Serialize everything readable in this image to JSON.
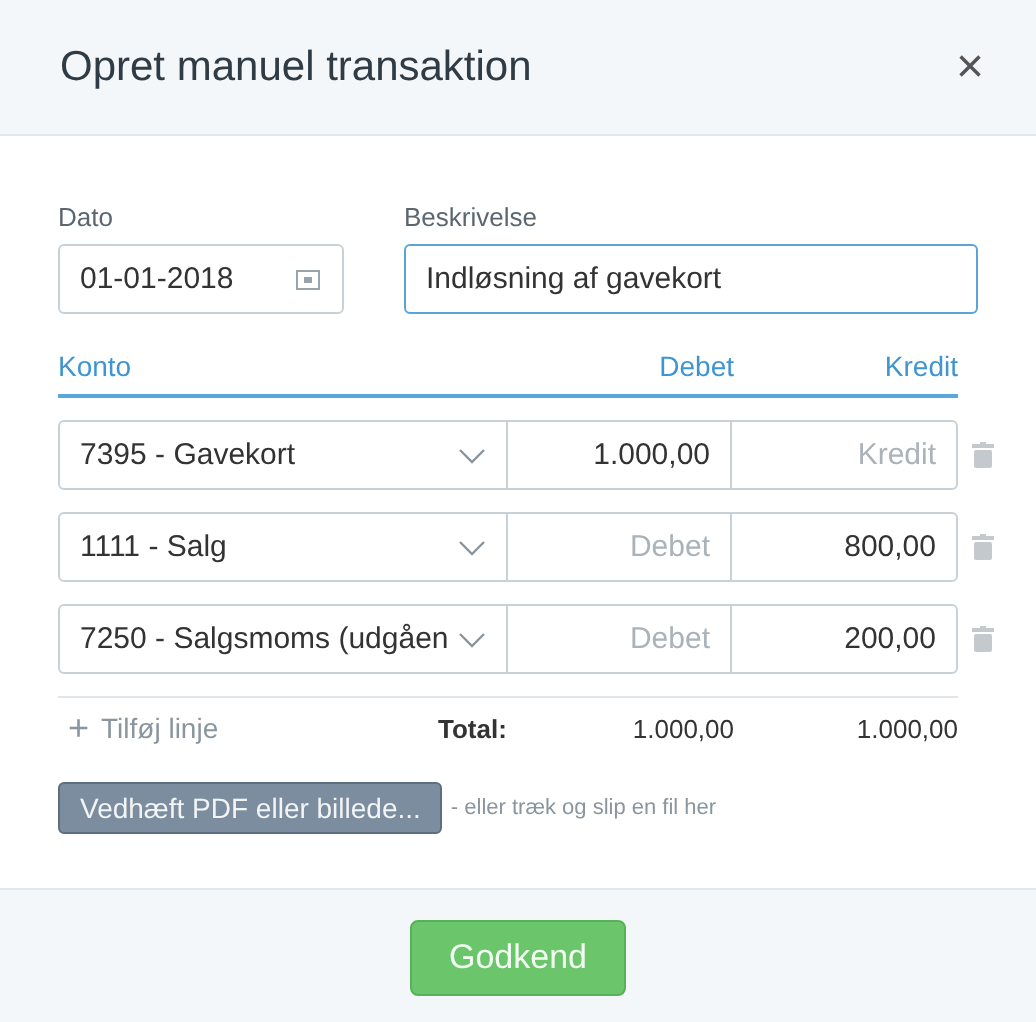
{
  "window": {
    "title": "Opret manuel transaktion",
    "close": "×"
  },
  "date": {
    "label": "Dato",
    "value": "01-01-2018"
  },
  "description": {
    "label": "Beskrivelse",
    "value": "Indløsning af gavekort",
    "focused": true
  },
  "columns": [
    "Konto",
    "Debet",
    "Kredit"
  ],
  "lines": [
    {
      "account": "7395 - Gavekort",
      "debit": {
        "value": "1.000,00"
      },
      "credit": {
        "placeholder": "Kredit"
      }
    },
    {
      "account": "1111 - Salg",
      "debit": {
        "placeholder": "Debet"
      },
      "credit": {
        "value": "800,00"
      }
    },
    {
      "account": "7250 - Salgsmoms (udgåen",
      "debit": {
        "placeholder": "Debet"
      },
      "credit": {
        "value": "200,00"
      }
    }
  ],
  "add_line": {
    "icon": "+",
    "label": "Tilføj linje"
  },
  "totals": {
    "label": "Total:",
    "debit": "1.000,00",
    "credit": "1.000,00"
  },
  "attach": {
    "button": "Vedhæft PDF eller billede...",
    "hint": "- eller træk og slip en fil her"
  },
  "submit": "Godkend"
}
